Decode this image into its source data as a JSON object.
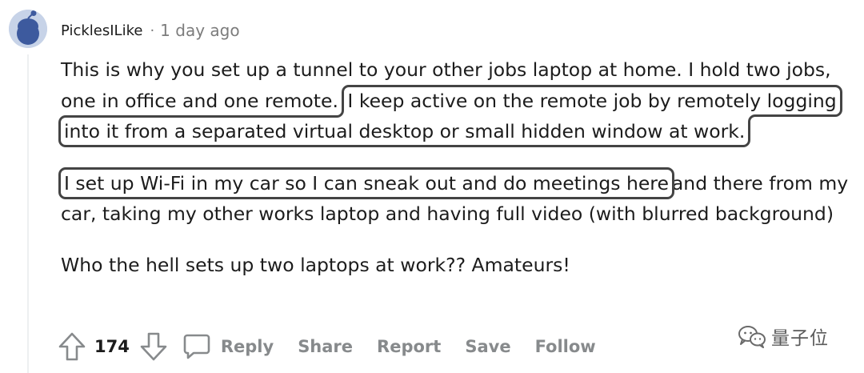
{
  "comment": {
    "username": "PicklesILike",
    "separator": "·",
    "timestamp": "1 day ago",
    "body": {
      "p1_a": "This is why you set up a tunnel to your other jobs laptop at home. I hold two jobs, one in office and one remote.",
      "p1_highlight": "I keep active on the remote job by remotely logging into it from a separated virtual desktop or small hidden window at work.",
      "p2_highlight": "I set up Wi-Fi in my car so I can sneak out and do meetings here",
      "p2_b": "and there from my car, taking my other works laptop and having full video (with blurred background)",
      "p3": "Who the hell sets up two laptops at work?? Amateurs!"
    }
  },
  "actions": {
    "upvote_icon": "arrow-up-outline-icon",
    "vote_count": "174",
    "downvote_icon": "arrow-down-outline-icon",
    "reply_icon": "speech-bubble-icon",
    "reply": "Reply",
    "share": "Share",
    "report": "Report",
    "save": "Save",
    "follow": "Follow"
  },
  "watermark": {
    "text": "量子位",
    "icon": "wechat-icon"
  },
  "colors": {
    "text": "#1c1c1c",
    "meta": "#7c7c7c",
    "action": "#878a8c",
    "highlight_border": "#444444",
    "avatar_bg": "#c7d3e8",
    "avatar_fg": "#3d5a9e"
  }
}
